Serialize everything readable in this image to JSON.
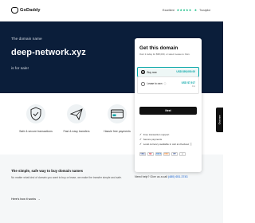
{
  "header": {
    "logo_text": "GoDaddy",
    "trust_label": "Excellent",
    "trust_stars": "★★★★★",
    "trustpilot_text": "Trustpilot",
    "trustpilot_star": "★"
  },
  "hero": {
    "eyebrow": "The domain name",
    "domain": "deep-network.xyz",
    "sale_text": "is for sale!"
  },
  "offer_card": {
    "title": "Get this domain",
    "subtitle": "Own it today for $95,000, or select Lease to Own.",
    "options": [
      {
        "label": "Buy now",
        "info": "",
        "price": "USD $95,000.00",
        "sub": "",
        "selected": true
      },
      {
        "label": "Lease to own",
        "info": "ⓘ",
        "price": "USD $7,917",
        "sub": "/mo",
        "selected": false
      }
    ],
    "next_label": "Next",
    "features": [
      "Free transaction support",
      "Secure payments",
      "Local currency available in cart at checkout ⓘ"
    ],
    "payment_methods": [
      "VISA",
      "MC",
      "AMEX",
      "DISC",
      "PP",
      "•••"
    ]
  },
  "chat_tab": {
    "label": "Chat now"
  },
  "features_row": [
    {
      "label": "Safe & secure transactions",
      "icon": "shield-check-icon"
    },
    {
      "label": "Fast & easy transfers",
      "icon": "paper-plane-icon"
    },
    {
      "label": "Hassle free payments",
      "icon": "credit-card-icon"
    }
  ],
  "help": {
    "text": "Need help? Give us a call",
    "phone": "(480) 651-3743"
  },
  "bottom": {
    "title": "The simple, safe way to buy domain names",
    "body": "No matter what kind of domain you want to buy or lease, we make the transfer simple and safe.",
    "link": "Here's how it works",
    "link_arrow": "→"
  },
  "colors": {
    "accent": "#00a4a6",
    "hero_bg": "#0b1e3a",
    "button": "#111111"
  }
}
